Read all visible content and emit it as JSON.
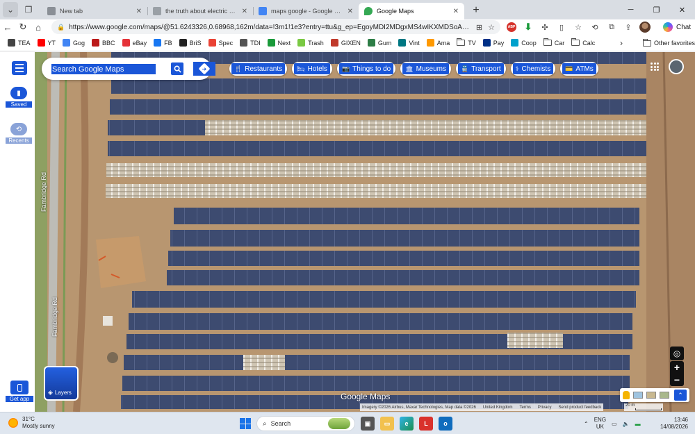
{
  "browser": {
    "tabs": [
      {
        "title": "New tab",
        "icon": "new-tab-icon",
        "active": false
      },
      {
        "title": "the truth about electric cars - Pag",
        "icon": "page-icon",
        "active": false
      },
      {
        "title": "maps google - Google Search",
        "icon": "google-icon",
        "active": false
      },
      {
        "title": "Google Maps",
        "icon": "google-maps-icon",
        "active": true
      }
    ],
    "address_url": "https://www.google.com/maps/@51.6243326,0.68968,162m/data=!3m1!1e3?entry=ttu&g_ep=EgoyMDI2MDgxMS4wIKXMDSoASAFQAw%3D%...",
    "copilot_label": "Chat"
  },
  "bookmarks": {
    "items": [
      {
        "label": "TEA",
        "icon": "globe-icon",
        "color": "#444444"
      },
      {
        "label": "YT",
        "icon": "youtube-icon",
        "color": "#ff0000"
      },
      {
        "label": "Gog",
        "icon": "google-icon",
        "color": "#4285f4"
      },
      {
        "label": "BBC",
        "icon": "bbc-icon",
        "color": "#bb1919"
      },
      {
        "label": "eBay",
        "icon": "ebay-icon",
        "color": "#e53238"
      },
      {
        "label": "FB",
        "icon": "facebook-icon",
        "color": "#1877f2"
      },
      {
        "label": "BriS",
        "icon": "bris-icon",
        "color": "#222222"
      },
      {
        "label": "Spec",
        "icon": "gmail-icon",
        "color": "#ea4335"
      },
      {
        "label": "TDI",
        "icon": "tdi-icon",
        "color": "#555555"
      },
      {
        "label": "Next",
        "icon": "next-icon",
        "color": "#1a9a3a"
      },
      {
        "label": "Trash",
        "icon": "trash-icon",
        "color": "#7ac943"
      },
      {
        "label": "GIXEN",
        "icon": "gixen-icon",
        "color": "#c0392b"
      },
      {
        "label": "Gum",
        "icon": "gumtree-icon",
        "color": "#2d7d46"
      },
      {
        "label": "Vint",
        "icon": "vinted-icon",
        "color": "#007782"
      },
      {
        "label": "Ama",
        "icon": "amazon-icon",
        "color": "#ff9900"
      },
      {
        "label": "TV",
        "icon": "folder-icon",
        "color": "",
        "folder": true
      },
      {
        "label": "Pay",
        "icon": "paypal-icon",
        "color": "#003087"
      },
      {
        "label": "Coop",
        "icon": "coop-icon",
        "color": "#00a1cc"
      },
      {
        "label": "Car",
        "icon": "folder-icon",
        "color": "",
        "folder": true
      },
      {
        "label": "Calc",
        "icon": "folder-icon",
        "color": "",
        "folder": true
      }
    ],
    "other_favorites": "Other favorites"
  },
  "maps": {
    "search_placeholder": "Search Google Maps",
    "chips": [
      {
        "label": "Restaurants",
        "icon": "fork-knife-icon",
        "glyph": "🍴"
      },
      {
        "label": "Hotels",
        "icon": "bed-icon",
        "glyph": "🛏"
      },
      {
        "label": "Things to do",
        "icon": "camera-icon",
        "glyph": "📷"
      },
      {
        "label": "Museums",
        "icon": "museum-icon",
        "glyph": "🏛"
      },
      {
        "label": "Transport",
        "icon": "transit-icon",
        "glyph": "🚆"
      },
      {
        "label": "Chemists",
        "icon": "pharmacy-icon",
        "glyph": "⚕"
      },
      {
        "label": "ATMs",
        "icon": "atm-icon",
        "glyph": "💳"
      }
    ],
    "rail": {
      "saved": "Saved",
      "recents": "Recents",
      "get_app": "Get app"
    },
    "layers_label": "Layers",
    "road_name": "Fambridge Rd",
    "logo_text": "Google Maps",
    "attribution": {
      "imagery": "Imagery ©2026 Airbus, Maxar Technologies, Map data ©2026",
      "country": "United Kingdom",
      "terms": "Terms",
      "privacy": "Privacy",
      "feedback": "Send product feedback"
    },
    "scale_label": "20 m",
    "colors": {
      "accent": "#1a56d8",
      "field": "#b89670",
      "panel": "#3b4a6b"
    }
  },
  "taskbar": {
    "weather_temp": "31°C",
    "weather_desc": "Mostly sunny",
    "search_label": "Search",
    "lang_primary": "ENG",
    "lang_secondary": "UK",
    "time": "13:46",
    "date": "14/08/2026"
  }
}
